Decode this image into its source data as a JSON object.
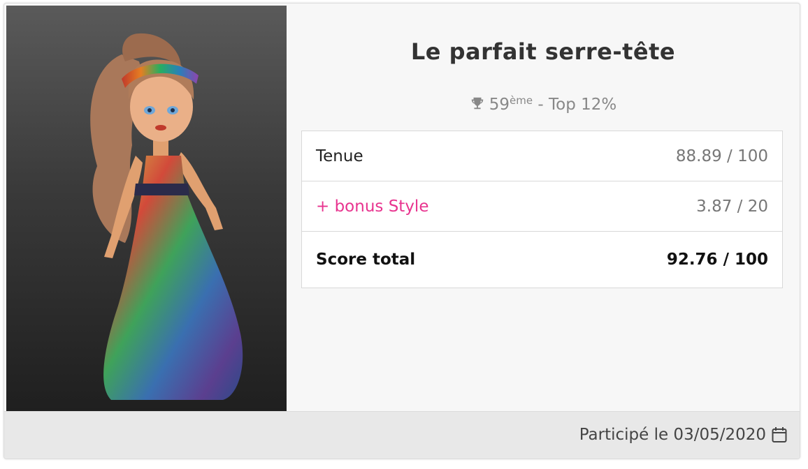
{
  "contest": {
    "title": "Le parfait serre-tête",
    "rank_number": "59",
    "rank_suffix": "ème",
    "rank_rest": " - Top 12%",
    "rank_icon": "trophy-icon"
  },
  "scores": {
    "rows": [
      {
        "label": "Tenue",
        "value": "88.89 / 100"
      },
      {
        "label": "+ bonus Style",
        "value": "3.87 / 20"
      },
      {
        "label": "Score total",
        "value": "92.76 / 100"
      }
    ]
  },
  "footer": {
    "text": "Participé le 03/05/2020",
    "icon": "calendar-icon"
  },
  "colors": {
    "bonus": "#e8348f",
    "panel_bg": "#f7f7f7",
    "footer_bg": "#e8e8e8"
  }
}
